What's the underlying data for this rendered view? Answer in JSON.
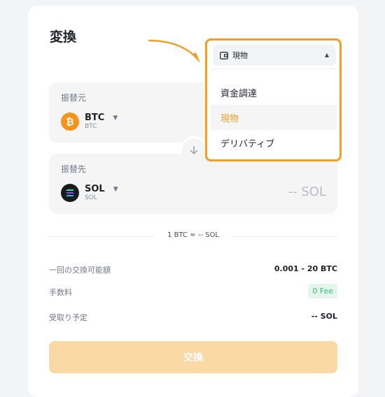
{
  "page": {
    "title": "変換"
  },
  "from": {
    "label": "振替元",
    "coin": {
      "symbol": "BTC",
      "name": "BTC",
      "icon": "bitcoin-icon",
      "color": "#f7931a"
    }
  },
  "to": {
    "label": "振替先",
    "coin": {
      "symbol": "SOL",
      "name": "SOL",
      "icon": "solana-icon",
      "color": "#1b1b1f"
    },
    "amount": "-- SOL"
  },
  "rate": "1 BTC ≈ -- SOL",
  "info": [
    {
      "label": "一回の交換可能額",
      "value": "0.001 - 20 BTC"
    },
    {
      "label": "手数料",
      "value": "0 Fee"
    },
    {
      "label": "受取り予定",
      "value": "-- SOL"
    }
  ],
  "convert_button": "交換",
  "wallet_dropdown": {
    "selected": "現物",
    "options": [
      "資金調達",
      "現物",
      "デリバティブ"
    ],
    "highlight_color": "#f0a028"
  },
  "colors": {
    "accent": "#f0a028",
    "fee_green": "#2ebd85",
    "button_disabled": "#fad9a4"
  }
}
